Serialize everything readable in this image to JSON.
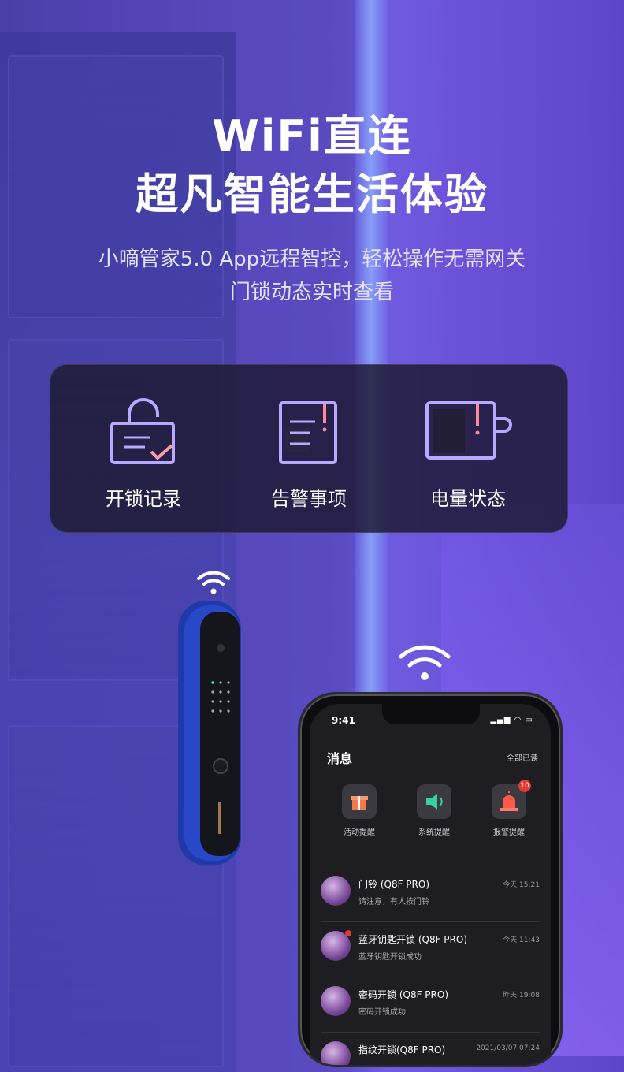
{
  "hero": {
    "title_line1": "WiFi直连",
    "title_line2": "超凡智能生活体验",
    "subtitle_line1": "小嘀管家5.0 App远程智控，轻松操作无需网关",
    "subtitle_line2": "门锁动态实时查看"
  },
  "features": [
    {
      "label": "开锁记录",
      "icon": "unlock-record-icon"
    },
    {
      "label": "告警事项",
      "icon": "alert-document-icon"
    },
    {
      "label": "电量状态",
      "icon": "battery-status-icon"
    }
  ],
  "phone": {
    "status_time": "9:41",
    "app_title": "消息",
    "read_all": "全部已读",
    "categories": [
      {
        "label": "活动提醒",
        "icon": "gift-icon",
        "color": "#f07a4a"
      },
      {
        "label": "系统提醒",
        "icon": "speaker-icon",
        "color": "#3ad0a0"
      },
      {
        "label": "报警提醒",
        "icon": "alarm-light-icon",
        "color": "#ff5a4a",
        "badge": "10"
      }
    ],
    "messages": [
      {
        "name": "门铃 (Q8F PRO)",
        "desc": "请注意，有人按门铃",
        "time": "今天 15:21",
        "unread": false
      },
      {
        "name": "蓝牙钥匙开锁 (Q8F PRO)",
        "desc": "蓝牙钥匙开锁成功",
        "time": "今天 11:43",
        "unread": true
      },
      {
        "name": "密码开锁 (Q8F PRO)",
        "desc": "密码开锁成功",
        "time": "昨天 19:08",
        "unread": false
      },
      {
        "name": "指纹开锁(Q8F PRO)",
        "desc": "",
        "time": "2021/03/07 07:24",
        "unread": false
      }
    ]
  },
  "colors": {
    "accent": "#8a6cf0",
    "alert": "#e53935"
  }
}
